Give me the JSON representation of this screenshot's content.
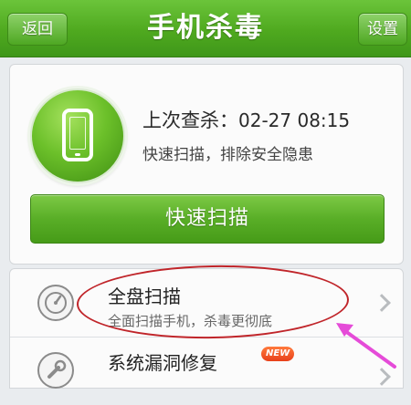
{
  "header": {
    "title": "手机杀毒",
    "back_label": "返回",
    "settings_label": "设置"
  },
  "status_card": {
    "last_scan_label": "上次查杀：",
    "last_scan_time": "02-27 08:15",
    "description": "快速扫描，排除安全隐患",
    "quick_scan_button": "快速扫描"
  },
  "list": {
    "items": [
      {
        "title": "全盘扫描",
        "subtitle": "全面扫描手机，杀毒更彻底",
        "icon": "gauge-icon"
      },
      {
        "title": "系统漏洞修复",
        "badge": "NEW",
        "icon": "wrench-icon"
      }
    ]
  },
  "colors": {
    "brand_green": "#4fa91f",
    "annotation_red": "#c0252a",
    "annotation_arrow": "#e54bd8",
    "badge_orange": "#f05a22"
  }
}
